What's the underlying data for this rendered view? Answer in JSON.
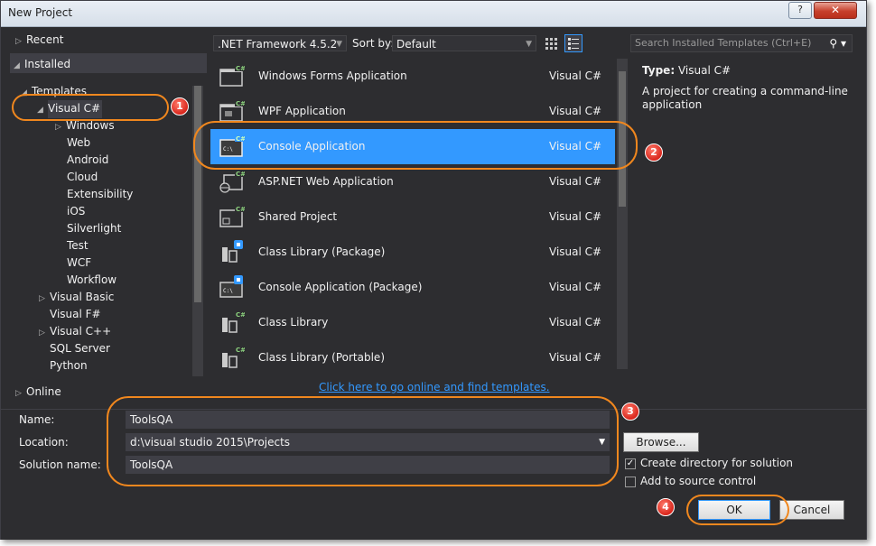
{
  "window": {
    "title": "New Project",
    "help": "?",
    "close": "✕"
  },
  "tree": {
    "recent": "Recent",
    "installed": "Installed",
    "templates": "Templates",
    "visual_csharp": "Visual C#",
    "children": [
      "Windows",
      "Web",
      "Android",
      "Cloud",
      "Extensibility",
      "iOS",
      "Silverlight",
      "Test",
      "WCF",
      "Workflow"
    ],
    "visual_basic": "Visual Basic",
    "visual_fsharp": "Visual F#",
    "visual_cpp": "Visual C++",
    "sql_server": "SQL Server",
    "python": "Python",
    "online": "Online"
  },
  "toolbar": {
    "framework": ".NET Framework 4.5.2",
    "sort_label": "Sort by:",
    "sort_value": "Default",
    "search_placeholder": "Search Installed Templates (Ctrl+E)"
  },
  "templates": [
    {
      "name": "Windows Forms Application",
      "lang": "Visual C#"
    },
    {
      "name": "WPF Application",
      "lang": "Visual C#"
    },
    {
      "name": "Console Application",
      "lang": "Visual C#"
    },
    {
      "name": "ASP.NET Web Application",
      "lang": "Visual C#"
    },
    {
      "name": "Shared Project",
      "lang": "Visual C#"
    },
    {
      "name": "Class Library (Package)",
      "lang": "Visual C#"
    },
    {
      "name": "Console Application (Package)",
      "lang": "Visual C#"
    },
    {
      "name": "Class Library",
      "lang": "Visual C#"
    },
    {
      "name": "Class Library (Portable)",
      "lang": "Visual C#"
    }
  ],
  "selected_template_index": 2,
  "description": {
    "type_label": "Type:",
    "type_value": "Visual C#",
    "text": "A project for creating a command-line application"
  },
  "online_link": "Click here to go online and find templates.",
  "form": {
    "name_label": "Name:",
    "name_value": "ToolsQA",
    "location_label": "Location:",
    "location_value": "d:\\visual studio 2015\\Projects",
    "solution_label": "Solution name:",
    "solution_value": "ToolsQA",
    "browse": "Browse...",
    "create_dir": "Create directory for solution",
    "create_dir_checked": true,
    "source_control": "Add to source control",
    "source_control_checked": false,
    "ok": "OK",
    "cancel": "Cancel"
  },
  "annotations": [
    "1",
    "2",
    "3",
    "4"
  ],
  "colors": {
    "accent": "#3399ff",
    "highlight_oval": "#f0871e",
    "badge": "#d9261c",
    "background": "#2d2d30"
  }
}
